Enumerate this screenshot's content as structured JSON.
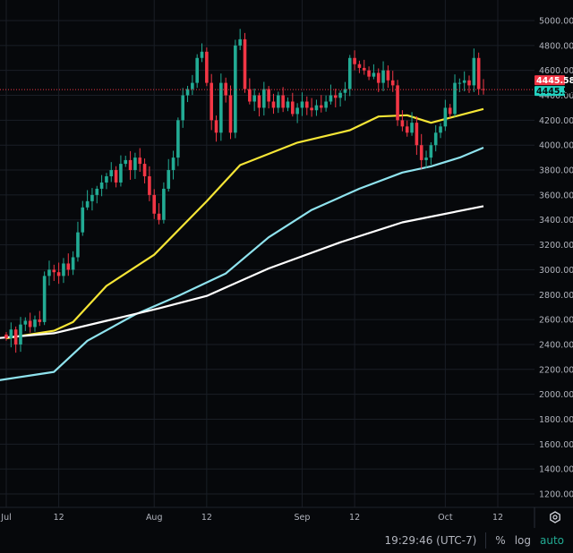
{
  "chart_data": {
    "type": "candlestick",
    "start_date": "Jul 1",
    "y_ticks": [
      5000,
      4800,
      4600,
      4400,
      4200,
      4000,
      3800,
      3600,
      3400,
      3200,
      3000,
      2800,
      2600,
      2400,
      2200,
      2000,
      1800,
      1600,
      1400,
      1200
    ],
    "y_tick_labels": [
      "5000.00",
      "4800.00",
      "4600.00",
      "4400.00",
      "4200.00",
      "4000.00",
      "3800.00",
      "3600.00",
      "3400.00",
      "3200.00",
      "3000.00",
      "2800.00",
      "2600.00",
      "2400.00",
      "2200.00",
      "2000.00",
      "1800.00",
      "1600.00",
      "1400.00",
      "1200.00"
    ],
    "ylim": [
      1130,
      5160
    ],
    "x_ticks": [
      {
        "day": 0,
        "label": "Jul"
      },
      {
        "day": 11,
        "label": "12"
      },
      {
        "day": 31,
        "label": "Aug"
      },
      {
        "day": 42,
        "label": "12"
      },
      {
        "day": 62,
        "label": "Sep"
      },
      {
        "day": 73,
        "label": "12"
      },
      {
        "day": 92,
        "label": "Oct"
      },
      {
        "day": 103,
        "label": "12"
      }
    ],
    "first_open": 2480,
    "closes": [
      2450,
      2520,
      2400,
      2560,
      2590,
      2540,
      2600,
      2580,
      2950,
      3000,
      2980,
      2950,
      3050,
      3000,
      3100,
      3300,
      3500,
      3550,
      3600,
      3650,
      3700,
      3750,
      3800,
      3700,
      3850,
      3880,
      3800,
      3900,
      3850,
      3750,
      3600,
      3450,
      3400,
      3650,
      3800,
      3900,
      4200,
      4400,
      4450,
      4500,
      4700,
      4750,
      4500,
      4200,
      4100,
      4500,
      4400,
      4100,
      4800,
      4850,
      4450,
      4350,
      4400,
      4300,
      4450,
      4350,
      4300,
      4400,
      4300,
      4350,
      4250,
      4300,
      4350,
      4300,
      4280,
      4320,
      4300,
      4350,
      4400,
      4380,
      4420,
      4450,
      4700,
      4650,
      4620,
      4600,
      4550,
      4580,
      4500,
      4600,
      4520,
      4480,
      4200,
      4150,
      4100,
      4180,
      4000,
      3880,
      3900,
      4000,
      4100,
      4150,
      4300,
      4250,
      4500,
      4500,
      4520,
      4480,
      4700,
      4450,
      4445.58
    ],
    "series": [
      {
        "name": "MA yellow",
        "color": "#f5e536",
        "points": [
          [
            0,
            2450
          ],
          [
            10,
            2510
          ],
          [
            14,
            2580
          ],
          [
            21,
            2870
          ],
          [
            31,
            3120
          ],
          [
            42,
            3550
          ],
          [
            49,
            3840
          ],
          [
            61,
            4020
          ],
          [
            72,
            4120
          ],
          [
            78,
            4230
          ],
          [
            84,
            4240
          ],
          [
            89,
            4180
          ],
          [
            94,
            4230
          ],
          [
            100,
            4290
          ]
        ]
      },
      {
        "name": "MA cyan",
        "color": "#8fe3ee",
        "points": [
          [
            -2,
            2110
          ],
          [
            10,
            2180
          ],
          [
            17,
            2430
          ],
          [
            27,
            2640
          ],
          [
            36,
            2790
          ],
          [
            46,
            2970
          ],
          [
            55,
            3260
          ],
          [
            64,
            3480
          ],
          [
            74,
            3650
          ],
          [
            83,
            3780
          ],
          [
            89,
            3830
          ],
          [
            95,
            3900
          ],
          [
            100,
            3980
          ]
        ]
      },
      {
        "name": "MA white",
        "color": "#ffffff",
        "points": [
          [
            -2,
            2450
          ],
          [
            10,
            2490
          ],
          [
            21,
            2590
          ],
          [
            32,
            2690
          ],
          [
            42,
            2790
          ],
          [
            55,
            3010
          ],
          [
            70,
            3220
          ],
          [
            83,
            3380
          ],
          [
            100,
            3510
          ]
        ]
      }
    ],
    "last_price": {
      "label_sell": "4445.58",
      "label_buy": "4445.58",
      "value": 4445.58,
      "sell_color": "#f23645",
      "buy_color": "#22d1c0"
    },
    "up_color": "#22ab94",
    "down_color": "#f23645"
  },
  "status_bar": {
    "time": "19:29:46 (UTC-7)",
    "percent": "%",
    "log": "log",
    "auto": "auto"
  }
}
